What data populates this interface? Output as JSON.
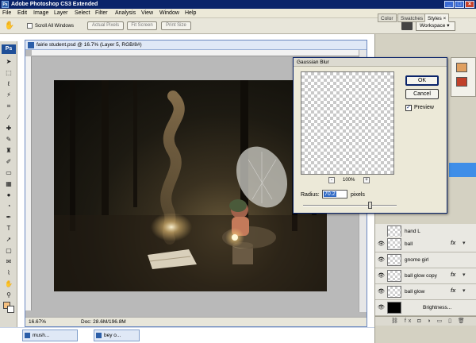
{
  "window": {
    "app_icon": "Ps",
    "title": "Adobe Photoshop CS3 Extended"
  },
  "menu": [
    "File",
    "Edit",
    "Image",
    "Layer",
    "Select",
    "Filter",
    "Analysis",
    "View",
    "Window",
    "Help"
  ],
  "options_bar": {
    "scroll_all_windows": "Scroll All Windows",
    "actual_pixels": "Actual Pixels",
    "fit_screen": "Fit Screen",
    "print_size": "Print Size",
    "workspace": "Workspace ▾"
  },
  "toolbox": {
    "logo": "Ps",
    "foreground_color": "#f5c080",
    "background_color": "#ffffff"
  },
  "document": {
    "title": "fairie student.psd @ 16.7% (Layer 5, RGB/8#)",
    "zoom": "16.67%",
    "doc_size": "Doc: 28.6M/196.8M"
  },
  "gaussian_blur": {
    "title": "Gaussian Blur",
    "ok": "OK",
    "cancel": "Cancel",
    "preview_label": "Preview",
    "preview_checked": "✓",
    "zoom_out": "-",
    "zoom_in": "+",
    "zoom_percent": "100%",
    "radius_label": "Radius:",
    "radius_value": "70.2",
    "units": "pixels",
    "slider_fraction": 0.72
  },
  "panels": {
    "tabs": [
      "Color",
      "Swatches",
      "Styles ×"
    ],
    "active_tab": "Styles ×"
  },
  "layers": [
    {
      "name": "hand L",
      "visible": false,
      "fx": false
    },
    {
      "name": "ball",
      "visible": true,
      "fx": true
    },
    {
      "name": "gnome girl",
      "visible": true,
      "fx": false
    },
    {
      "name": "ball glow copy",
      "visible": true,
      "fx": true
    },
    {
      "name": "ball glow",
      "visible": true,
      "fx": true
    },
    {
      "name": "Brightness...",
      "visible": true,
      "fx": false
    }
  ],
  "taskbar": [
    "mush...",
    "bey o..."
  ],
  "colors": {
    "titlebar": "#0a246a",
    "selection": "#3f8ee8",
    "menu_bg": "#ece9d8"
  }
}
